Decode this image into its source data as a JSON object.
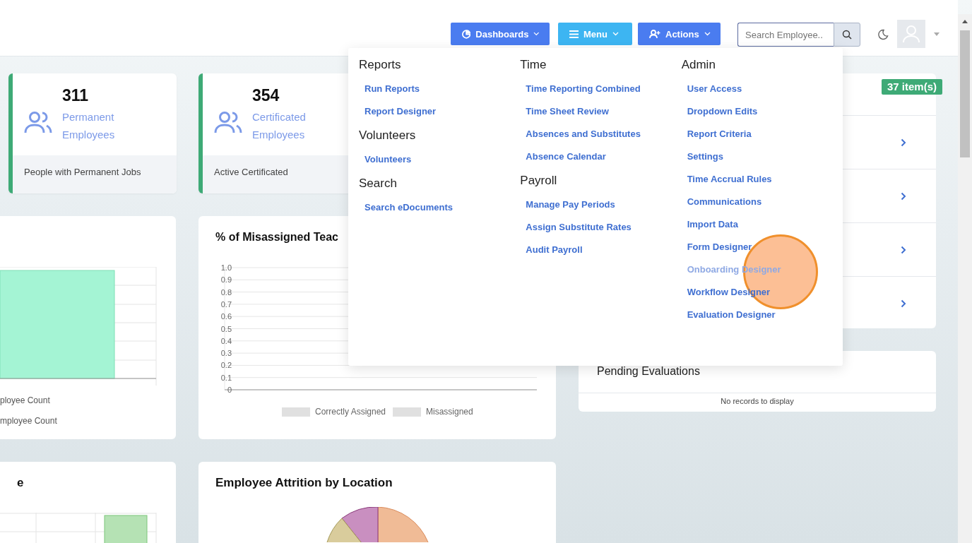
{
  "header": {
    "buttons": [
      {
        "label": "Dashboards",
        "kind": "dashboards"
      },
      {
        "label": "Menu",
        "kind": "menu"
      },
      {
        "label": "Actions",
        "kind": "actions"
      }
    ],
    "search": {
      "placeholder": "Search Employee.."
    }
  },
  "stat_cards": [
    {
      "value": "311",
      "label": "Permanent Employees",
      "footer": "People with Permanent Jobs"
    },
    {
      "value": "354",
      "label": "Certificated Employees",
      "footer": "Active Certificated"
    }
  ],
  "charts": [
    {
      "legend": [
        "ployee Count",
        "mployee Count"
      ]
    },
    {
      "title": "% of Misassigned Teac",
      "chart_data": {
        "type": "bar",
        "grid": true,
        "ylim": [
          0,
          1
        ],
        "yticks": [
          {
            "value": 0,
            "label": "0"
          },
          {
            "value": 0.1,
            "label": "0.1"
          },
          {
            "value": 0.2,
            "label": "0.2"
          },
          {
            "value": 0.3,
            "label": "0.3"
          },
          {
            "value": 0.4,
            "label": "0.4"
          },
          {
            "value": 0.5,
            "label": "0.5"
          },
          {
            "value": 0.6,
            "label": "0.6"
          },
          {
            "value": 0.7,
            "label": "0.7"
          },
          {
            "value": 0.8,
            "label": "0.8"
          },
          {
            "value": 0.9,
            "label": "0.9"
          },
          {
            "value": 1,
            "label": "1.0"
          }
        ],
        "series": [
          {
            "name": "Correctly Assigned",
            "color": "#e0e0e0"
          },
          {
            "name": "Misassigned",
            "color": "#e0e0e0"
          }
        ]
      }
    },
    {
      "title": "e"
    },
    {
      "title": "Employee Attrition by Location"
    }
  ],
  "list_card": {
    "badge": "37 item(s)"
  },
  "pending": {
    "title": "Pending Evaluations",
    "empty": "No records to display"
  },
  "menu": {
    "columns": [
      [
        {
          "title": "Reports",
          "items": [
            {
              "label": "Run Reports",
              "hovered": false
            },
            {
              "label": "Report Designer",
              "hovered": false
            }
          ]
        },
        {
          "title": "Volunteers",
          "items": [
            {
              "label": "Volunteers",
              "hovered": false
            }
          ]
        },
        {
          "title": "Search",
          "items": [
            {
              "label": "Search eDocuments",
              "hovered": false
            }
          ]
        }
      ],
      [
        {
          "title": "Time",
          "items": [
            {
              "label": "Time Reporting Combined",
              "hovered": false
            },
            {
              "label": "Time Sheet Review",
              "hovered": false
            },
            {
              "label": "Absences and Substitutes",
              "hovered": false
            },
            {
              "label": "Absence Calendar",
              "hovered": false
            }
          ]
        },
        {
          "title": "Payroll",
          "items": [
            {
              "label": "Manage Pay Periods",
              "hovered": false
            },
            {
              "label": "Assign Substitute Rates",
              "hovered": false
            },
            {
              "label": "Audit Payroll",
              "hovered": false
            }
          ]
        }
      ],
      [
        {
          "title": "Admin",
          "items": [
            {
              "label": "User Access",
              "hovered": false
            },
            {
              "label": "Dropdown Edits",
              "hovered": false
            },
            {
              "label": "Report Criteria",
              "hovered": false
            },
            {
              "label": "Settings",
              "hovered": false
            },
            {
              "label": "Time Accrual Rules",
              "hovered": false
            },
            {
              "label": "Communications",
              "hovered": false
            },
            {
              "label": "Import Data",
              "hovered": false
            },
            {
              "label": "Form Designer",
              "hovered": false
            },
            {
              "label": "Onboarding Designer",
              "hovered": true
            },
            {
              "label": "Workflow Designer",
              "hovered": false
            },
            {
              "label": "Evaluation Designer",
              "hovered": false
            }
          ]
        }
      ]
    ]
  }
}
